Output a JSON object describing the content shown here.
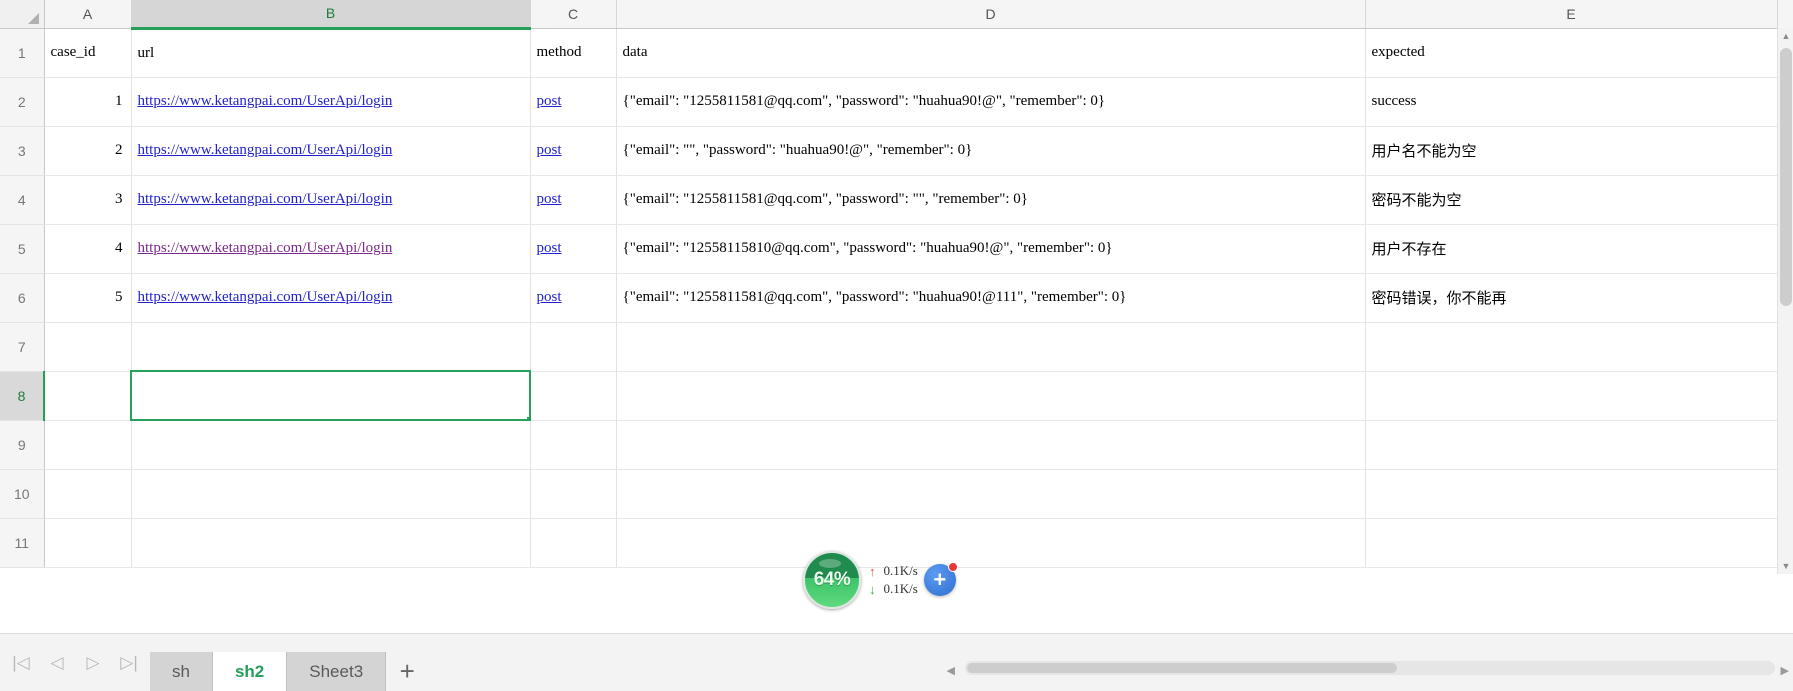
{
  "window": {
    "title": "sh2"
  },
  "grid": {
    "corner_icon": "select-all-triangle-icon",
    "column_headers": [
      "A",
      "B",
      "C",
      "D",
      "E"
    ],
    "selected_column": "B",
    "selected_row": "8",
    "selected_cell": "B8",
    "row_headers": [
      "1",
      "2",
      "3",
      "4",
      "5",
      "6",
      "7",
      "8",
      "9",
      "10",
      "11"
    ],
    "header_row": {
      "A": "case_id",
      "B": "url",
      "C": "method",
      "D": "data",
      "E": "expected"
    },
    "rows": [
      {
        "row": "2",
        "case_id": "1",
        "url": "https://www.ketangpai.com/UserApi/login",
        "url_visited": false,
        "method": "post",
        "data": "{\"email\": \"1255811581@qq.com\", \"password\": \"huahua90!@\", \"remember\": 0}",
        "expected": "success"
      },
      {
        "row": "3",
        "case_id": "2",
        "url": "https://www.ketangpai.com/UserApi/login",
        "url_visited": false,
        "method": "post",
        "data": "{\"email\": \"\", \"password\": \"huahua90!@\", \"remember\": 0}",
        "expected": "用户名不能为空"
      },
      {
        "row": "4",
        "case_id": "3",
        "url": "https://www.ketangpai.com/UserApi/login",
        "url_visited": false,
        "method": "post",
        "data": "{\"email\": \"1255811581@qq.com\", \"password\": \"\", \"remember\": 0}",
        "expected": "密码不能为空"
      },
      {
        "row": "5",
        "case_id": "4",
        "url": "https://www.ketangpai.com/UserApi/login",
        "url_visited": true,
        "method": "post",
        "data": "{\"email\": \"12558115810@qq.com\", \"password\": \"huahua90!@\", \"remember\": 0}",
        "expected": "用户不存在"
      },
      {
        "row": "6",
        "case_id": "5",
        "url": "https://www.ketangpai.com/UserApi/login",
        "url_visited": false,
        "method": "post",
        "data": "{\"email\": \"1255811581@qq.com\", \"password\": \"huahua90!@111\", \"remember\": 0}",
        "expected": "密码错误，你不能再"
      },
      {
        "row": "7",
        "case_id": "",
        "url": "",
        "url_visited": false,
        "method": "",
        "data": "",
        "expected": ""
      },
      {
        "row": "8",
        "case_id": "",
        "url": "",
        "url_visited": false,
        "method": "",
        "data": "",
        "expected": ""
      },
      {
        "row": "9",
        "case_id": "",
        "url": "",
        "url_visited": false,
        "method": "",
        "data": "",
        "expected": ""
      },
      {
        "row": "10",
        "case_id": "",
        "url": "",
        "url_visited": false,
        "method": "",
        "data": "",
        "expected": ""
      },
      {
        "row": "11",
        "case_id": "",
        "url": "",
        "url_visited": false,
        "method": "",
        "data": "",
        "expected": ""
      }
    ]
  },
  "sheet_tabs": {
    "nav": {
      "first": "|◁",
      "prev": "◁",
      "next": "▷",
      "last": "▷|"
    },
    "tabs": [
      {
        "label": "sh",
        "active": false
      },
      {
        "label": "sh2",
        "active": true
      },
      {
        "label": "Sheet3",
        "active": false
      }
    ],
    "add_label": "+"
  },
  "scrollbars": {
    "v_up": "▲",
    "v_down": "▼",
    "h_left": "◀",
    "h_right": "▶"
  },
  "net_widget": {
    "percent": "64%",
    "upload_arrow": "↑",
    "upload_speed": "0.1K/s",
    "download_arrow": "↓",
    "download_speed": "0.1K/s",
    "plus_label": "+",
    "accent_green": "#3cc468",
    "accent_blue": "#2f6fd0",
    "badge_red": "#e53935"
  },
  "colors": {
    "selection_green": "#24a05a",
    "link_blue": "#2222cc",
    "link_visited": "#7a2a8a",
    "header_gray": "#f5f5f5"
  }
}
